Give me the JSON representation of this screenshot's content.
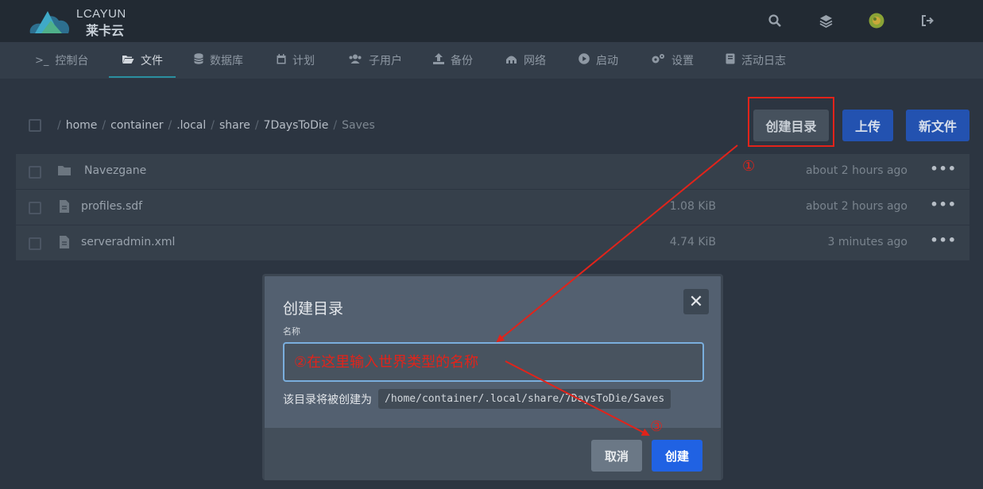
{
  "brand": {
    "name": "LCAYUN",
    "name_cn": "莱卡云"
  },
  "top_icons": [
    "search-icon",
    "layers-icon",
    "avatar-icon",
    "sign-out-icon"
  ],
  "nav": {
    "items": [
      {
        "label": "控制台",
        "icon": "terminal-icon"
      },
      {
        "label": "文件",
        "icon": "folder-open-icon"
      },
      {
        "label": "数据库",
        "icon": "database-icon"
      },
      {
        "label": "计划",
        "icon": "calendar-icon"
      },
      {
        "label": "子用户",
        "icon": "users-icon"
      },
      {
        "label": "备份",
        "icon": "upload-icon"
      },
      {
        "label": "网络",
        "icon": "network-icon"
      },
      {
        "label": "启动",
        "icon": "play-icon"
      },
      {
        "label": "设置",
        "icon": "cogs-icon"
      },
      {
        "label": "活动日志",
        "icon": "book-icon"
      }
    ],
    "active": "文件"
  },
  "breadcrumb": {
    "separator": "/",
    "parts": [
      "home",
      "container",
      ".local",
      "share",
      "7DaysToDie",
      "Saves"
    ]
  },
  "actions": {
    "create_dir": "创建目录",
    "upload": "上传",
    "new_file": "新文件"
  },
  "files": [
    {
      "name": "Navezgane",
      "type": "folder",
      "size": "",
      "modified": "about 2 hours ago"
    },
    {
      "name": "profiles.sdf",
      "type": "file",
      "size": "1.08 KiB",
      "modified": "about 2 hours ago"
    },
    {
      "name": "serveradmin.xml",
      "type": "file",
      "size": "4.74 KiB",
      "modified": "3 minutes ago"
    }
  ],
  "annotations": {
    "step1": "①",
    "step3": "③",
    "color": "#e2231a"
  },
  "modal": {
    "title": "创建目录",
    "close": "✕",
    "field_label": "名称",
    "input_placeholder": "②在这里输入世界类型的名称",
    "hint_prefix": "该目录将被创建为",
    "target_path": "/home/container/.local/share/7DaysToDie/Saves",
    "cancel": "取消",
    "create": "创建"
  }
}
